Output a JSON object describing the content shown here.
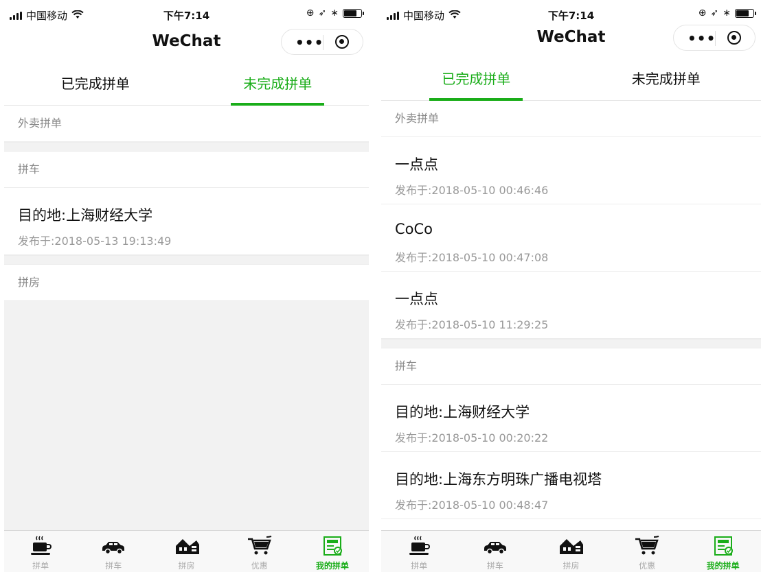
{
  "left": {
    "status": {
      "carrier": "中国移动",
      "time": "下午7:14"
    },
    "nav": {
      "title": "WeChat",
      "more": "•••"
    },
    "tabs": [
      {
        "label": "已完成拼单",
        "active": false
      },
      {
        "label": "未完成拼单",
        "active": true
      }
    ],
    "sections": {
      "takeout": {
        "header": "外卖拼单"
      },
      "carpool": {
        "header": "拼车",
        "items": [
          {
            "title": "目的地:上海财经大学",
            "time": "发布于:2018-05-13 19:13:49"
          }
        ]
      },
      "room": {
        "header": "拼房"
      }
    },
    "tabbar": [
      {
        "label": "拼单",
        "icon": "coffee-cup-icon"
      },
      {
        "label": "拼车",
        "icon": "car-icon"
      },
      {
        "label": "拼房",
        "icon": "house-icon"
      },
      {
        "label": "优惠",
        "icon": "shopping-cart-icon"
      },
      {
        "label": "我的拼单",
        "icon": "my-orders-icon",
        "active": true
      }
    ]
  },
  "right": {
    "status": {
      "carrier": "中国移动",
      "time": "下午7:14"
    },
    "nav": {
      "title": "WeChat",
      "more": "•••"
    },
    "tabs": [
      {
        "label": "已完成拼单",
        "active": true
      },
      {
        "label": "未完成拼单",
        "active": false
      }
    ],
    "sections": {
      "takeout": {
        "header": "外卖拼单",
        "items": [
          {
            "title": "一点点",
            "time": "发布于:2018-05-10 00:46:46"
          },
          {
            "title": "CoCo",
            "time": "发布于:2018-05-10 00:47:08"
          },
          {
            "title": "一点点",
            "time": "发布于:2018-05-10 11:29:25"
          }
        ]
      },
      "carpool": {
        "header": "拼车",
        "items": [
          {
            "title": "目的地:上海财经大学",
            "time": "发布于:2018-05-10 00:20:22"
          },
          {
            "title": "目的地:上海东方明珠广播电视塔",
            "time": "发布于:2018-05-10 00:48:47"
          }
        ]
      }
    },
    "tabbar": [
      {
        "label": "拼单",
        "icon": "coffee-cup-icon"
      },
      {
        "label": "拼车",
        "icon": "car-icon"
      },
      {
        "label": "拼房",
        "icon": "house-icon"
      },
      {
        "label": "优惠",
        "icon": "shopping-cart-icon"
      },
      {
        "label": "我的拼单",
        "icon": "my-orders-icon",
        "active": true
      }
    ]
  },
  "colors": {
    "accent": "#1aad19",
    "muted": "#999999",
    "divider": "#ececec",
    "background_gap": "#f2f2f2"
  }
}
